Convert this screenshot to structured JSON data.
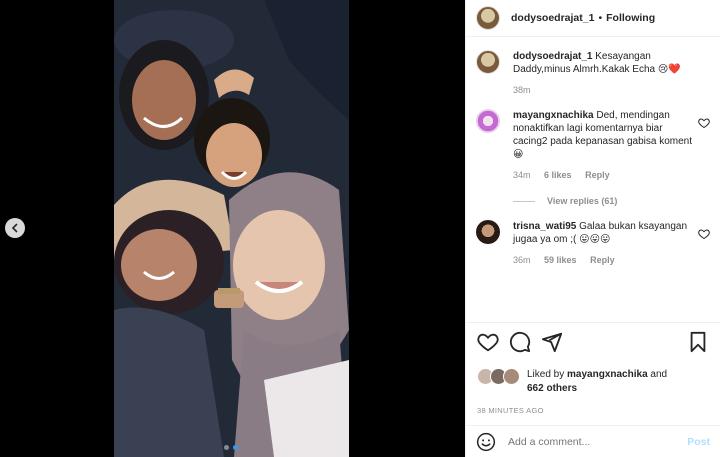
{
  "post": {
    "username": "dodysoedrajat_1",
    "separator": "•",
    "follow_status": "Following"
  },
  "caption": {
    "username": "dodysoedrajat_1",
    "text": "Kesayangan Daddy,minus Almrh.Kakak Echa 😢❤️",
    "time": "38m"
  },
  "comments": [
    {
      "username": "mayangxnachika",
      "text": "Ded, mendingan nonaktifkan lagi komentarnya biar cacing2 pada kepanasan gabisa koment😀",
      "time": "34m",
      "likes": "6 likes",
      "reply": "Reply",
      "view_replies": "View replies (61)"
    },
    {
      "username": "trisna_wati95",
      "text": "Galaa bukan ksayangan jugaa ya om ;( 😛😛😛",
      "time": "36m",
      "likes": "59 likes",
      "reply": "Reply"
    }
  ],
  "likes": {
    "prefix": "Liked by",
    "user": "mayangxnachika",
    "conj": "and",
    "others": "662 others"
  },
  "timestamp": "38 MINUTES AGO",
  "add_comment": {
    "placeholder": "Add a comment...",
    "post_label": "Post"
  },
  "carousel": {
    "slide_count": 2,
    "active_index": 0
  },
  "colors": {
    "link_blue": "#3897f0",
    "post_disabled": "#b2dffc",
    "muted": "#8e8e8e"
  }
}
